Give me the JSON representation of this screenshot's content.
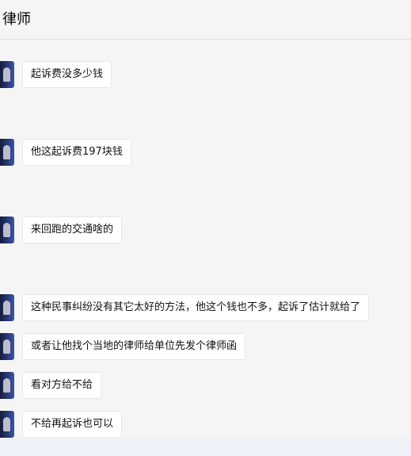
{
  "chat": {
    "title": "律师",
    "messages": [
      {
        "text": "起诉费没多少钱"
      },
      {
        "text": "他这起诉费197块钱"
      },
      {
        "text": "来回跑的交通啥的"
      },
      {
        "text": "这种民事纠纷没有其它太好的方法，他这个钱也不多，起诉了估计就给了"
      },
      {
        "text": "或者让他找个当地的律师给单位先发个律师函"
      },
      {
        "text": "看对方给不给"
      },
      {
        "text": "不给再起诉也可以"
      }
    ]
  },
  "icons": {
    "avatar": "contact-avatar"
  },
  "colors": {
    "chat_background": "#f5f5f5",
    "bubble_background": "#ffffff",
    "page_background": "#eef1f8",
    "avatar_blue": "#2b3d7e"
  }
}
